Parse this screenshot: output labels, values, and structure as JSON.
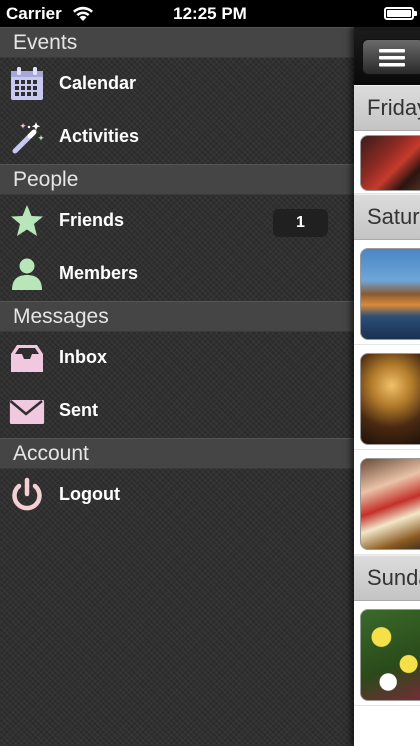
{
  "status_bar": {
    "carrier": "Carrier",
    "time": "12:25 PM",
    "battery": "full"
  },
  "menu": {
    "sections": [
      {
        "title": "Events",
        "items": [
          {
            "label": "Calendar",
            "icon": "calendar-icon"
          },
          {
            "label": "Activities",
            "icon": "magic-wand-icon"
          }
        ]
      },
      {
        "title": "People",
        "items": [
          {
            "label": "Friends",
            "icon": "star-icon",
            "badge": "1"
          },
          {
            "label": "Members",
            "icon": "person-icon"
          }
        ]
      },
      {
        "title": "Messages",
        "items": [
          {
            "label": "Inbox",
            "icon": "inbox-tray-icon"
          },
          {
            "label": "Sent",
            "icon": "envelope-icon"
          }
        ]
      },
      {
        "title": "Account",
        "items": [
          {
            "label": "Logout",
            "icon": "power-icon"
          }
        ]
      }
    ]
  },
  "content": {
    "days": [
      {
        "label": "Friday",
        "photos": [
          "dance-party-photo"
        ]
      },
      {
        "label": "Saturday",
        "photos": [
          "bridge-night-photo",
          "carousel-photo",
          "oktoberfest-photo"
        ]
      },
      {
        "label": "Sunday",
        "photos": [
          "flowers-photo"
        ]
      }
    ]
  },
  "colors": {
    "menu_bg": "#2e2e2e",
    "section_header_bg": "#454545",
    "calendar_icon": "#c8c8f0",
    "star_icon": "#b8e6b8",
    "inbox_icon": "#f0c8e0",
    "power_icon": "#f4d0d4"
  }
}
